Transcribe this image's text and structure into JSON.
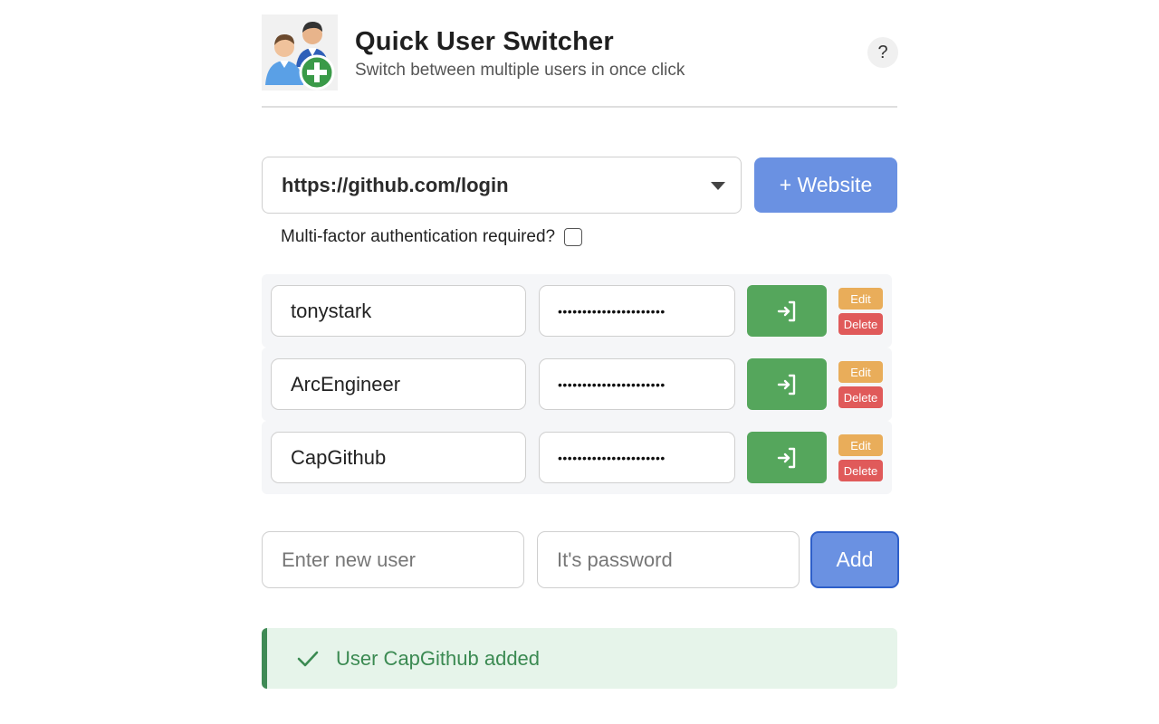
{
  "header": {
    "title": "Quick User Switcher",
    "subtitle": "Switch between multiple users in once click",
    "help_label": "?"
  },
  "website": {
    "selected": "https://github.com/login",
    "add_label": "+ Website",
    "mfa_label": "Multi-factor authentication required?",
    "mfa_checked": false
  },
  "users": [
    {
      "username": "tonystark",
      "password_mask": "••••••••••••••••••••••",
      "edit_label": "Edit",
      "delete_label": "Delete"
    },
    {
      "username": "ArcEngineer",
      "password_mask": "••••••••••••••••••••••",
      "edit_label": "Edit",
      "delete_label": "Delete"
    },
    {
      "username": "CapGithub",
      "password_mask": "••••••••••••••••••••••",
      "edit_label": "Edit",
      "delete_label": "Delete"
    }
  ],
  "new_user": {
    "user_placeholder": "Enter new user",
    "password_placeholder": "It's password",
    "add_label": "Add"
  },
  "status": {
    "message": "User CapGithub added",
    "icon": "check-icon"
  },
  "colors": {
    "primary": "#6a91e2",
    "login": "#55a65c",
    "edit": "#e9ad5a",
    "delete": "#e05a5a",
    "success_bg": "#e6f4ea",
    "success_text": "#3b8a52"
  }
}
